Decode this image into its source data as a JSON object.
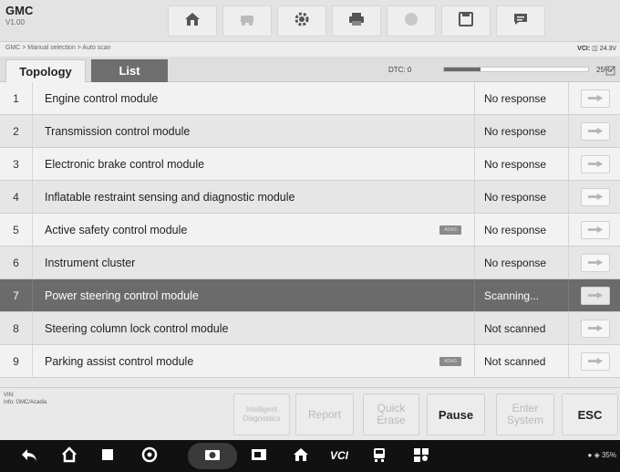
{
  "vehicle": {
    "make": "GMC",
    "version": "V1.00"
  },
  "toolbar": {
    "icons": [
      "home-icon",
      "vehicle-swap-icon",
      "settings-icon",
      "print-icon",
      "help-icon",
      "save-icon",
      "data-logging-icon"
    ]
  },
  "breadcrumb": "GMC > Manual selection > Auto scan",
  "vci": {
    "label": "VCI:",
    "voltage": "24.3V"
  },
  "tabs": {
    "topology": "Topology",
    "list": "List"
  },
  "scan": {
    "dtc_label": "DTC: 0",
    "progress": 0.25,
    "progress_label": "25%"
  },
  "modules": [
    {
      "num": "1",
      "name": "Engine control module",
      "status": "No response",
      "adas": false
    },
    {
      "num": "2",
      "name": "Transmission control module",
      "status": "No response",
      "adas": false
    },
    {
      "num": "3",
      "name": "Electronic brake control module",
      "status": "No response",
      "adas": false
    },
    {
      "num": "4",
      "name": "Inflatable restraint sensing and diagnostic module",
      "status": "No response",
      "adas": false
    },
    {
      "num": "5",
      "name": "Active safety control module",
      "status": "No response",
      "adas": true
    },
    {
      "num": "6",
      "name": "Instrument cluster",
      "status": "No response",
      "adas": false
    },
    {
      "num": "7",
      "name": "Power steering control module",
      "status": "Scanning...",
      "adas": false,
      "active": true
    },
    {
      "num": "8",
      "name": "Steering column lock control module",
      "status": "Not scanned",
      "adas": false
    },
    {
      "num": "9",
      "name": "Parking assist control module",
      "status": "Not scanned",
      "adas": true
    }
  ],
  "adas_label": "ADAS",
  "info": {
    "vin_label": "VIN:",
    "info_text": "Info: GMC/Acadia"
  },
  "actions": {
    "intelligent": "Intelligent Diagnostics",
    "report": "Report",
    "quick_erase": "Quick Erase",
    "pause": "Pause",
    "enter_system": "Enter System",
    "esc": "ESC"
  },
  "status_bar": {
    "battery": "35%"
  }
}
